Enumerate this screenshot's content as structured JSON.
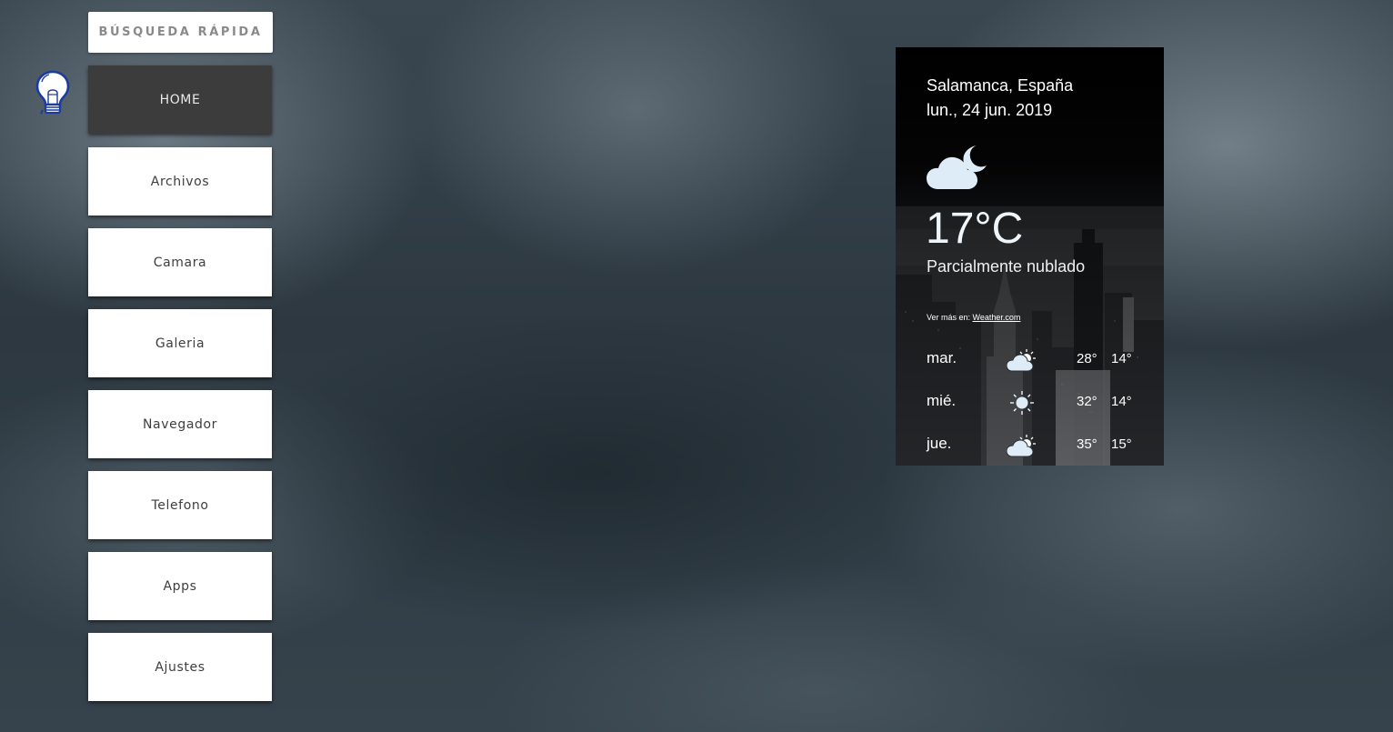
{
  "search": {
    "label": "BÚSQUEDA RÁPIDA"
  },
  "nav": {
    "items": [
      {
        "label": "HOME",
        "active": true
      },
      {
        "label": "Archivos"
      },
      {
        "label": "Camara"
      },
      {
        "label": "Galeria"
      },
      {
        "label": "Navegador"
      },
      {
        "label": "Telefono"
      },
      {
        "label": "Apps"
      },
      {
        "label": "Ajustes"
      }
    ]
  },
  "weather": {
    "location": "Salamanca, España",
    "date": "lun., 24 jun. 2019",
    "icon": "partly-cloudy-night-icon",
    "temperature": "17°C",
    "condition": "Parcialmente nublado",
    "more_prefix": "Ver más en:",
    "more_link": "Weather.com",
    "forecast": [
      {
        "day": "mar.",
        "icon": "partly-cloudy-icon",
        "high": "28°",
        "low": "14°"
      },
      {
        "day": "mié.",
        "icon": "sun-icon",
        "high": "32°",
        "low": "14°"
      },
      {
        "day": "jue.",
        "icon": "partly-cloudy-icon",
        "high": "35°",
        "low": "15°"
      }
    ]
  },
  "colors": {
    "active_nav": "#3c3c3c",
    "button_bg": "#ffffff",
    "weather_icon": "#ddecf7"
  }
}
